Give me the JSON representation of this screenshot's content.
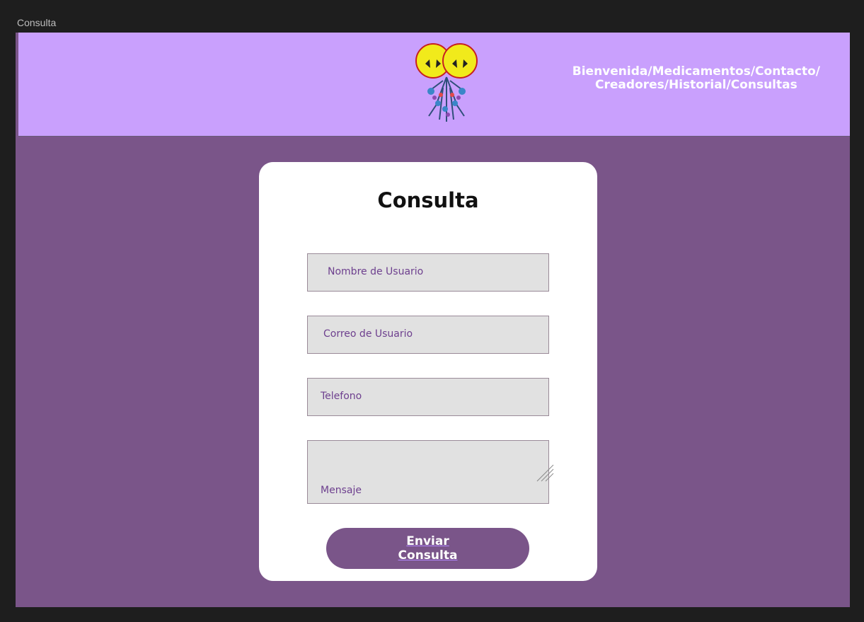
{
  "frame": {
    "label": "Consulta"
  },
  "header": {
    "nav_line1": "Bienvenida/Medicamentos/Contacto/",
    "nav_line2": "Creadores/Historial/Consultas",
    "logo_icon": "yellow-creature-logo-icon"
  },
  "form": {
    "title": "Consulta",
    "username_label": "Nombre de Usuario",
    "email_label": "Correo de Usuario",
    "phone_label": "Telefono",
    "message_label": "Mensaje",
    "submit_label": "Enviar Consulta"
  },
  "colors": {
    "header_bg": "#c9a0fd",
    "page_bg": "#7a5589",
    "card_bg": "#ffffff",
    "field_bg": "#e1e1e1",
    "field_text": "#6d3f8e"
  }
}
